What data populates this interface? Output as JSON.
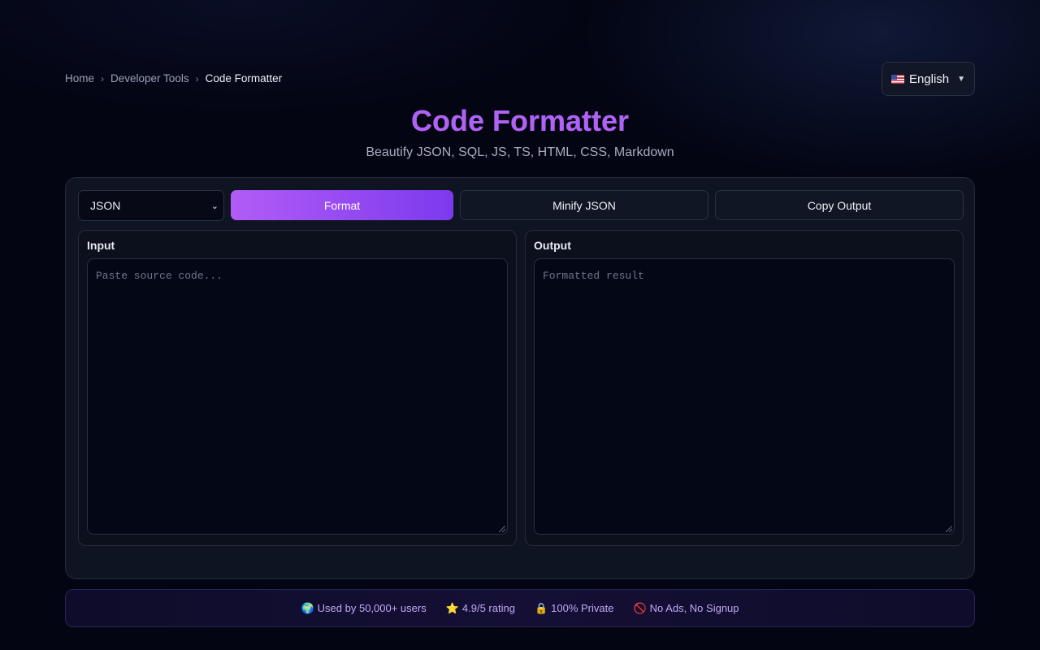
{
  "breadcrumb": {
    "items": [
      "Home",
      "Developer Tools"
    ],
    "current": "Code Formatter",
    "separator": "›"
  },
  "language": {
    "flag_icon": "us-flag-icon",
    "label": "English",
    "caret": "▼"
  },
  "header": {
    "title": "Code Formatter",
    "subtitle": "Beautify JSON, SQL, JS, TS, HTML, CSS, Markdown"
  },
  "toolbar": {
    "language_select_value": "JSON",
    "format_label": "Format",
    "minify_label": "Minify JSON",
    "copy_label": "Copy Output"
  },
  "input": {
    "label": "Input",
    "placeholder": "Paste source code..."
  },
  "output": {
    "label": "Output",
    "placeholder": "Formatted result"
  },
  "stats": [
    {
      "icon": "🌍",
      "text": "Used by 50,000+ users"
    },
    {
      "icon": "⭐",
      "text": "4.9/5 rating"
    },
    {
      "icon": "🔒",
      "text": "100% Private"
    },
    {
      "icon": "🚫",
      "text": "No Ads, No Signup"
    }
  ],
  "colors": {
    "accent_start": "#b25cf6",
    "accent_end": "#7c3aed",
    "background": "#030513"
  }
}
